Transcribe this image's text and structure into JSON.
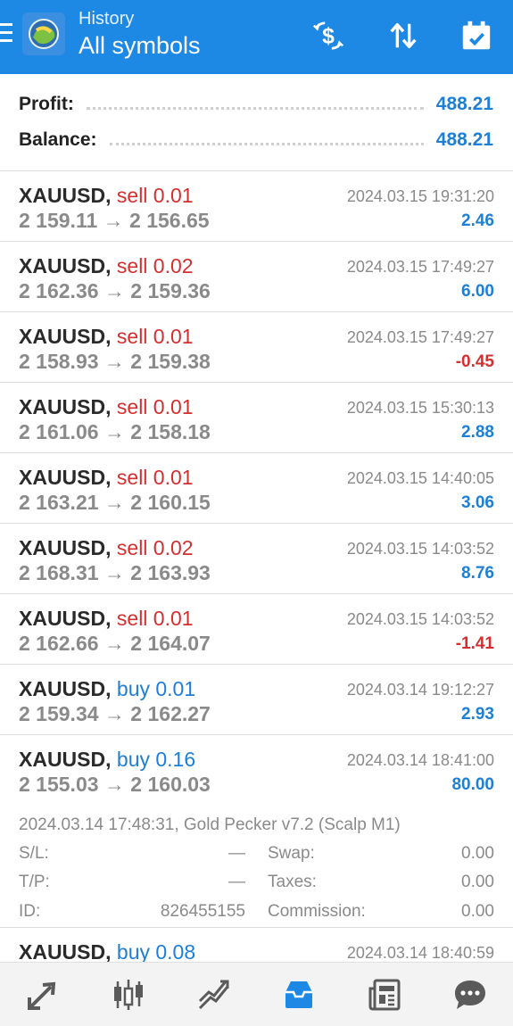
{
  "header": {
    "subtitle": "History",
    "title": "All symbols",
    "icons": [
      "menu-icon",
      "metatrader-logo",
      "deposit-icon",
      "sort-icon",
      "calendar-icon"
    ]
  },
  "summary": {
    "profit_label": "Profit:",
    "profit_value": "488.21",
    "balance_label": "Balance:",
    "balance_value": "488.21"
  },
  "deals": [
    {
      "symbol": "XAUUSD,",
      "type": "sell 0.01",
      "side": "sell",
      "prices": "2 159.11 → 2 156.65",
      "time": "2024.03.15 19:31:20",
      "profit": "2.46",
      "sign": "pos"
    },
    {
      "symbol": "XAUUSD,",
      "type": "sell 0.02",
      "side": "sell",
      "prices": "2 162.36 → 2 159.36",
      "time": "2024.03.15 17:49:27",
      "profit": "6.00",
      "sign": "pos"
    },
    {
      "symbol": "XAUUSD,",
      "type": "sell 0.01",
      "side": "sell",
      "prices": "2 158.93 → 2 159.38",
      "time": "2024.03.15 17:49:27",
      "profit": "-0.45",
      "sign": "neg"
    },
    {
      "symbol": "XAUUSD,",
      "type": "sell 0.01",
      "side": "sell",
      "prices": "2 161.06 → 2 158.18",
      "time": "2024.03.15 15:30:13",
      "profit": "2.88",
      "sign": "pos"
    },
    {
      "symbol": "XAUUSD,",
      "type": "sell 0.01",
      "side": "sell",
      "prices": "2 163.21 → 2 160.15",
      "time": "2024.03.15 14:40:05",
      "profit": "3.06",
      "sign": "pos"
    },
    {
      "symbol": "XAUUSD,",
      "type": "sell 0.02",
      "side": "sell",
      "prices": "2 168.31 → 2 163.93",
      "time": "2024.03.15 14:03:52",
      "profit": "8.76",
      "sign": "pos"
    },
    {
      "symbol": "XAUUSD,",
      "type": "sell 0.01",
      "side": "sell",
      "prices": "2 162.66 → 2 164.07",
      "time": "2024.03.15 14:03:52",
      "profit": "-1.41",
      "sign": "neg"
    },
    {
      "symbol": "XAUUSD,",
      "type": "buy 0.01",
      "side": "buy",
      "prices": "2 159.34 → 2 162.27",
      "time": "2024.03.14 19:12:27",
      "profit": "2.93",
      "sign": "pos"
    }
  ],
  "expanded_deal": {
    "symbol": "XAUUSD,",
    "type": "buy 0.16",
    "prices": "2 155.03 → 2 160.03",
    "time": "2024.03.14 18:41:00",
    "profit": "80.00",
    "comment": "2024.03.14 17:48:31, Gold Pecker v7.2 (Scalp M1)",
    "sl_label": "S/L:",
    "sl_value": "—",
    "swap_label": "Swap:",
    "swap_value": "0.00",
    "tp_label": "T/P:",
    "tp_value": "—",
    "taxes_label": "Taxes:",
    "taxes_value": "0.00",
    "id_label": "ID:",
    "id_value": "826455155",
    "commission_label": "Commission:",
    "commission_value": "0.00"
  },
  "partial_deal": {
    "symbol": "XAUUSD,",
    "type": "buy 0.08",
    "time": "2024.03.14 18:40:59"
  },
  "colors": {
    "header_bg": "#1e88e5",
    "profit_positive": "#1e7fd6",
    "profit_negative": "#d32f2f",
    "active_tab": "#1e88e5"
  },
  "bottom_nav": {
    "items": [
      "quotes-icon",
      "chart-icon",
      "trade-icon",
      "history-icon",
      "news-icon",
      "chat-icon"
    ],
    "active": "history-icon"
  }
}
